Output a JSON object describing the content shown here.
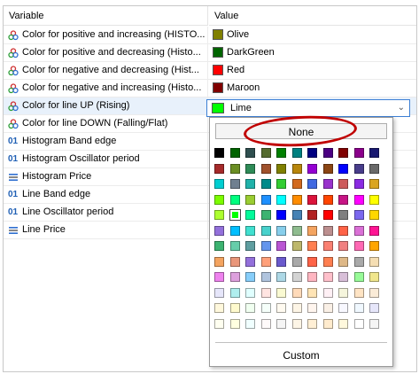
{
  "header": {
    "variable": "Variable",
    "value": "Value"
  },
  "rows": [
    {
      "label": "Color for positive and increasing (HISTO...",
      "type": "color",
      "value": "Olive",
      "color": "#808000"
    },
    {
      "label": "Color for positive and decreasing (Histo...",
      "type": "color",
      "value": "DarkGreen",
      "color": "#006400"
    },
    {
      "label": "Color for negative and decreasing (Hist...",
      "type": "color",
      "value": "Red",
      "color": "#ff0000"
    },
    {
      "label": "Color for negative and increasing (Histo...",
      "type": "color",
      "value": "Maroon",
      "color": "#800000"
    },
    {
      "label": "Color for line UP (Rising)",
      "type": "color",
      "value": "",
      "color": ""
    },
    {
      "label": "Color for line DOWN (Falling/Flat)",
      "type": "color",
      "value": "",
      "color": ""
    },
    {
      "label": "Histogram Band edge",
      "type": "int",
      "value": "",
      "color": ""
    },
    {
      "label": "Histogram Oscillator period",
      "type": "int",
      "value": "",
      "color": ""
    },
    {
      "label": "Histogram Price",
      "type": "enum",
      "value": "",
      "color": ""
    },
    {
      "label": "Line Band edge",
      "type": "int",
      "value": "",
      "color": ""
    },
    {
      "label": "Line Oscillator period",
      "type": "int",
      "value": "",
      "color": ""
    },
    {
      "label": "Line Price",
      "type": "enum",
      "value": "",
      "color": ""
    }
  ],
  "int_icon": "01",
  "combo": {
    "value": "Lime",
    "color": "#00ff00"
  },
  "picker": {
    "none_label": "None",
    "custom_label": "Custom",
    "selected": "#00ff00",
    "palette": [
      [
        "#000000",
        "#006400",
        "#2f4f4f",
        "#556b2f",
        "#008000",
        "#008080",
        "#000080",
        "#4b0082",
        "#800000",
        "#8b008b",
        "#191970"
      ],
      [
        "#a52a2a",
        "#6b8e23",
        "#2e8b57",
        "#a0522d",
        "#808000",
        "#b8860b",
        "#9400d3",
        "#8b4513",
        "#0000ff",
        "#483d8b",
        "#696969"
      ],
      [
        "#00ced1",
        "#708090",
        "#20b2aa",
        "#008b8b",
        "#32cd32",
        "#d2691e",
        "#4169e1",
        "#9932cc",
        "#cd5c5c",
        "#8a2be2",
        "#daa520"
      ],
      [
        "#7cfc00",
        "#00ff7f",
        "#9acd32",
        "#1e90ff",
        "#00ffff",
        "#ff8c00",
        "#dc143c",
        "#ff4500",
        "#c71585",
        "#ff00ff",
        "#ffff00"
      ],
      [
        "#adff2f",
        "#00ff00",
        "#00fa9a",
        "#3cb371",
        "#0000ff",
        "#4682b4",
        "#b22222",
        "#ff0000",
        "#808080",
        "#7b68ee",
        "#ffd700"
      ],
      [
        "#9370db",
        "#00bfff",
        "#40e0d0",
        "#48d1cc",
        "#87ceeb",
        "#8fbc8f",
        "#f4a460",
        "#bc8f8f",
        "#ff6347",
        "#da70d6",
        "#ff1493"
      ],
      [
        "#3cb371",
        "#66cdaa",
        "#5f9ea0",
        "#6495ed",
        "#ba55d3",
        "#bdb76b",
        "#ff7f50",
        "#fa8072",
        "#f08080",
        "#ff69b4",
        "#ffa500"
      ],
      [
        "#f4a460",
        "#e9967a",
        "#9370db",
        "#ffa07a",
        "#6a5acd",
        "#a9a9a9",
        "#ff6347",
        "#ff7f50",
        "#deb887",
        "#a9a9a9",
        "#f5deb3"
      ],
      [
        "#ee82ee",
        "#dda0dd",
        "#87cefa",
        "#b0c4de",
        "#add8e6",
        "#d3d3d3",
        "#ffb6c1",
        "#ffc0cb",
        "#d8bfd8",
        "#98fb98",
        "#f0e68c"
      ],
      [
        "#e6e6fa",
        "#afeeee",
        "#e0ffff",
        "#ffe4e1",
        "#fafad2",
        "#ffdab9",
        "#ffe4b5",
        "#fff0f5",
        "#f5f5dc",
        "#ffe4c4",
        "#faebd7"
      ],
      [
        "#fff8dc",
        "#fffacd",
        "#f0fff0",
        "#f5fffa",
        "#fffaf0",
        "#fdf5e6",
        "#fff5ee",
        "#faf0e6",
        "#f8f8ff",
        "#f0f8ff",
        "#e6e6fa"
      ],
      [
        "#fffff0",
        "#ffffe0",
        "#f0ffff",
        "#fffafa",
        "#f5f5f5",
        "#fdf5e6",
        "#ffefd5",
        "#ffebcd",
        "#fff8dc",
        "#ffffff",
        "#f5f5f5"
      ]
    ]
  }
}
